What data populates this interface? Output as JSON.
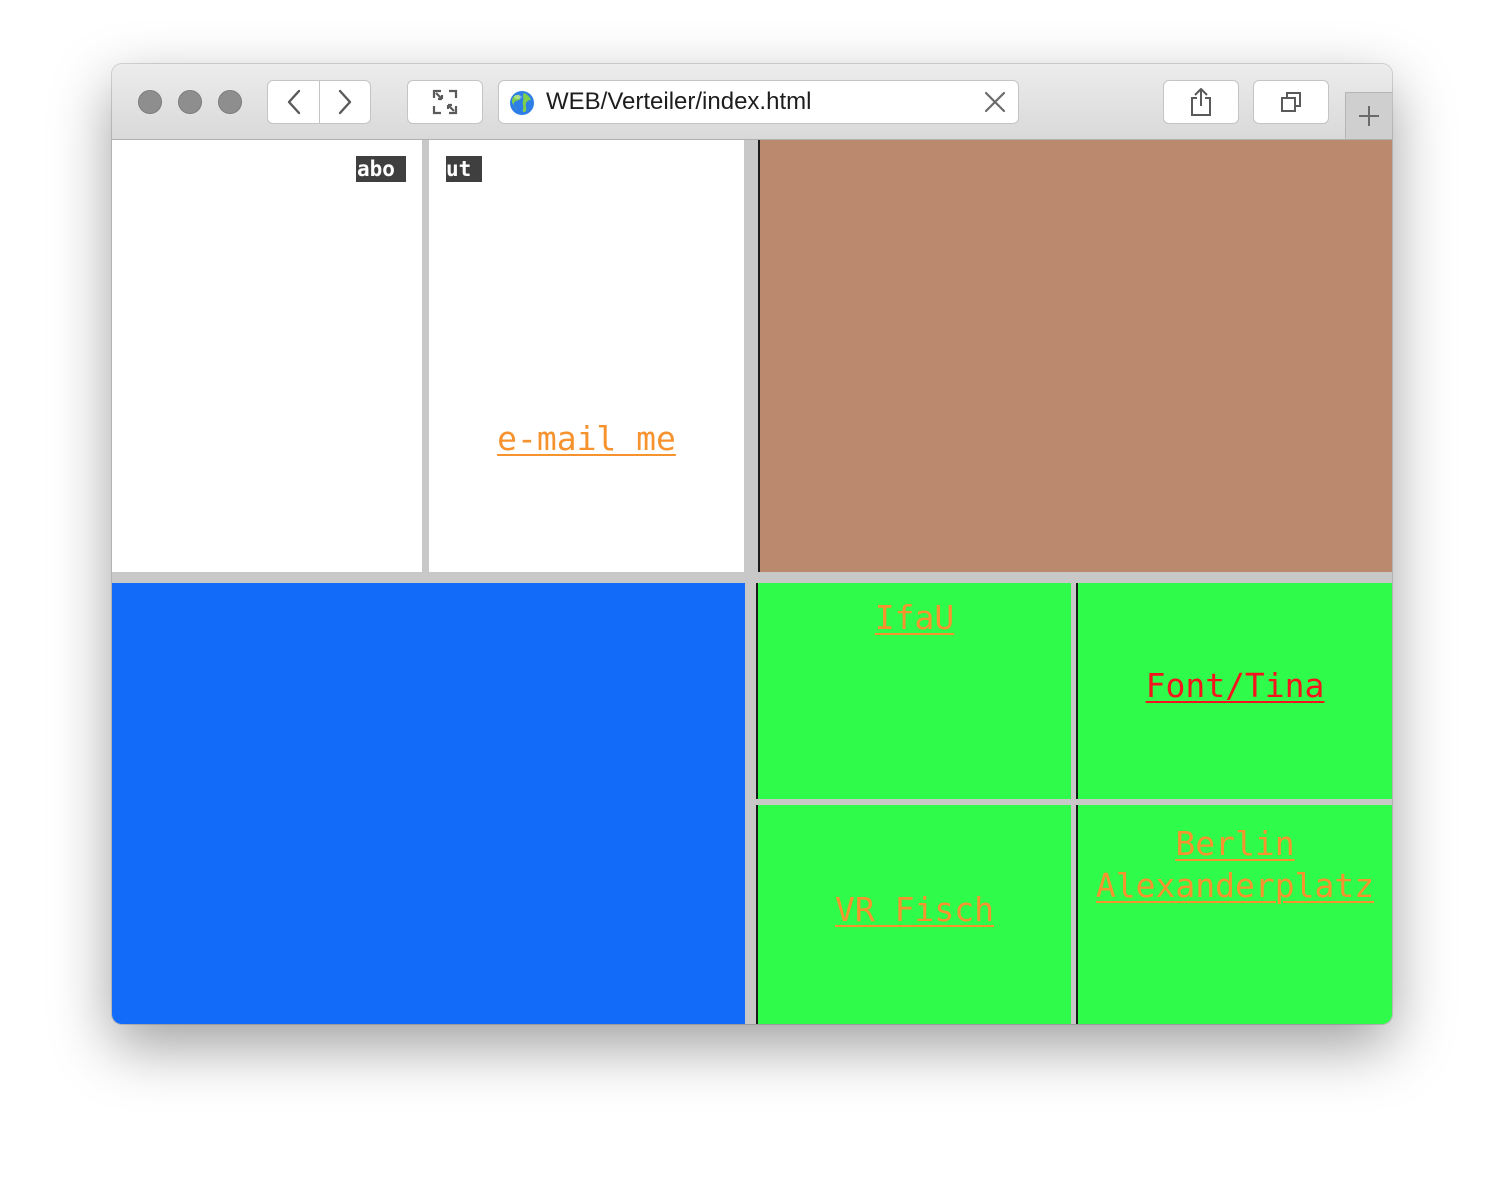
{
  "browser": {
    "url": "WEB/Verteiler/index.html",
    "buttons": {
      "close": "close-window",
      "minimize": "minimize-window",
      "zoom": "zoom-window",
      "back": "back",
      "forward": "forward",
      "fullscreen": "fullscreen",
      "share": "share",
      "tabs": "show-tabs",
      "new_tab": "new-tab"
    }
  },
  "frames": {
    "top_left": {
      "label": "abo",
      "color": "#ffffff"
    },
    "top_middle": {
      "label": "ut",
      "link": "e-mail me",
      "color": "#ffffff",
      "link_color": "#f7932f"
    },
    "top_right": {
      "color": "#bb8a6e"
    },
    "bottom_left": {
      "color": "#136bfa"
    },
    "green_grid": {
      "color": "#2ffc4a",
      "links": [
        {
          "text": "IfaU",
          "color": "#f7932f"
        },
        {
          "text": "Font/Tina",
          "color": "#f5141e"
        },
        {
          "text": "VR Fisch",
          "color": "#f7932f"
        },
        {
          "text_line1": "Berlin",
          "text_line2": "Alexanderplatz",
          "color": "#f7932f"
        }
      ]
    }
  }
}
